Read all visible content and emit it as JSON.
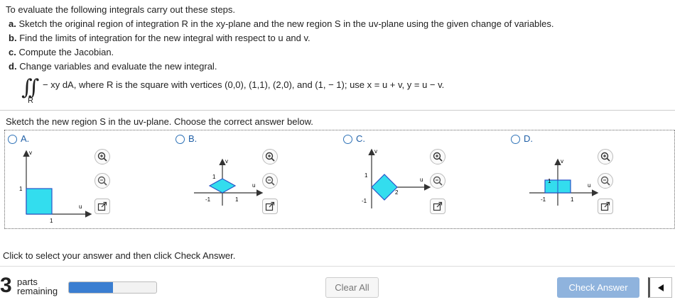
{
  "intro": {
    "line0": "To evaluate the following integrals carry out these steps.",
    "steps": [
      {
        "letter": "a.",
        "text": "Sketch the original region of integration R in the xy-plane and the new region S in the uv-plane using the given change of variables."
      },
      {
        "letter": "b.",
        "text": "Find the limits of integration for the new integral with respect to u and v."
      },
      {
        "letter": "c.",
        "text": "Compute the Jacobian."
      },
      {
        "letter": "d.",
        "text": "Change variables and evaluate the new integral."
      }
    ],
    "integral_sign": "∫∫",
    "integral_expr": "− xy dA, where R is the square with vertices (0,0), (1,1), (2,0), and (1, − 1); use x = u + v, y = u − v.",
    "integral_sub": "R"
  },
  "prompt": "Sketch the new region S in the uv-plane. Choose the correct answer below.",
  "options": [
    {
      "letter": "A.",
      "axis_u": "u",
      "axis_v": "v",
      "ticks": [
        "1",
        "1"
      ]
    },
    {
      "letter": "B.",
      "axis_u": "u",
      "axis_v": "v",
      "ticks": [
        "1",
        "-1",
        "1"
      ]
    },
    {
      "letter": "C.",
      "axis_u": "u",
      "axis_v": "v",
      "ticks": [
        "1",
        "-1",
        "2"
      ]
    },
    {
      "letter": "D.",
      "axis_u": "u",
      "axis_v": "v",
      "ticks": [
        "1",
        "-1",
        "1"
      ]
    }
  ],
  "tool_icons": [
    "zoom-in-icon",
    "zoom-out-icon",
    "popout-icon"
  ],
  "hint": "Click to select your answer and then click Check Answer.",
  "status": {
    "parts_num": "3",
    "parts_line1": "parts",
    "parts_line2": "remaining",
    "progress": 0.5
  },
  "buttons": {
    "clear": "Clear All",
    "check": "Check Answer"
  },
  "colors": {
    "accent": "#3a7ed1",
    "shape_fill": "#33ddee",
    "shape_stroke": "#2a55c8",
    "check_bg": "#8fb3dd"
  }
}
